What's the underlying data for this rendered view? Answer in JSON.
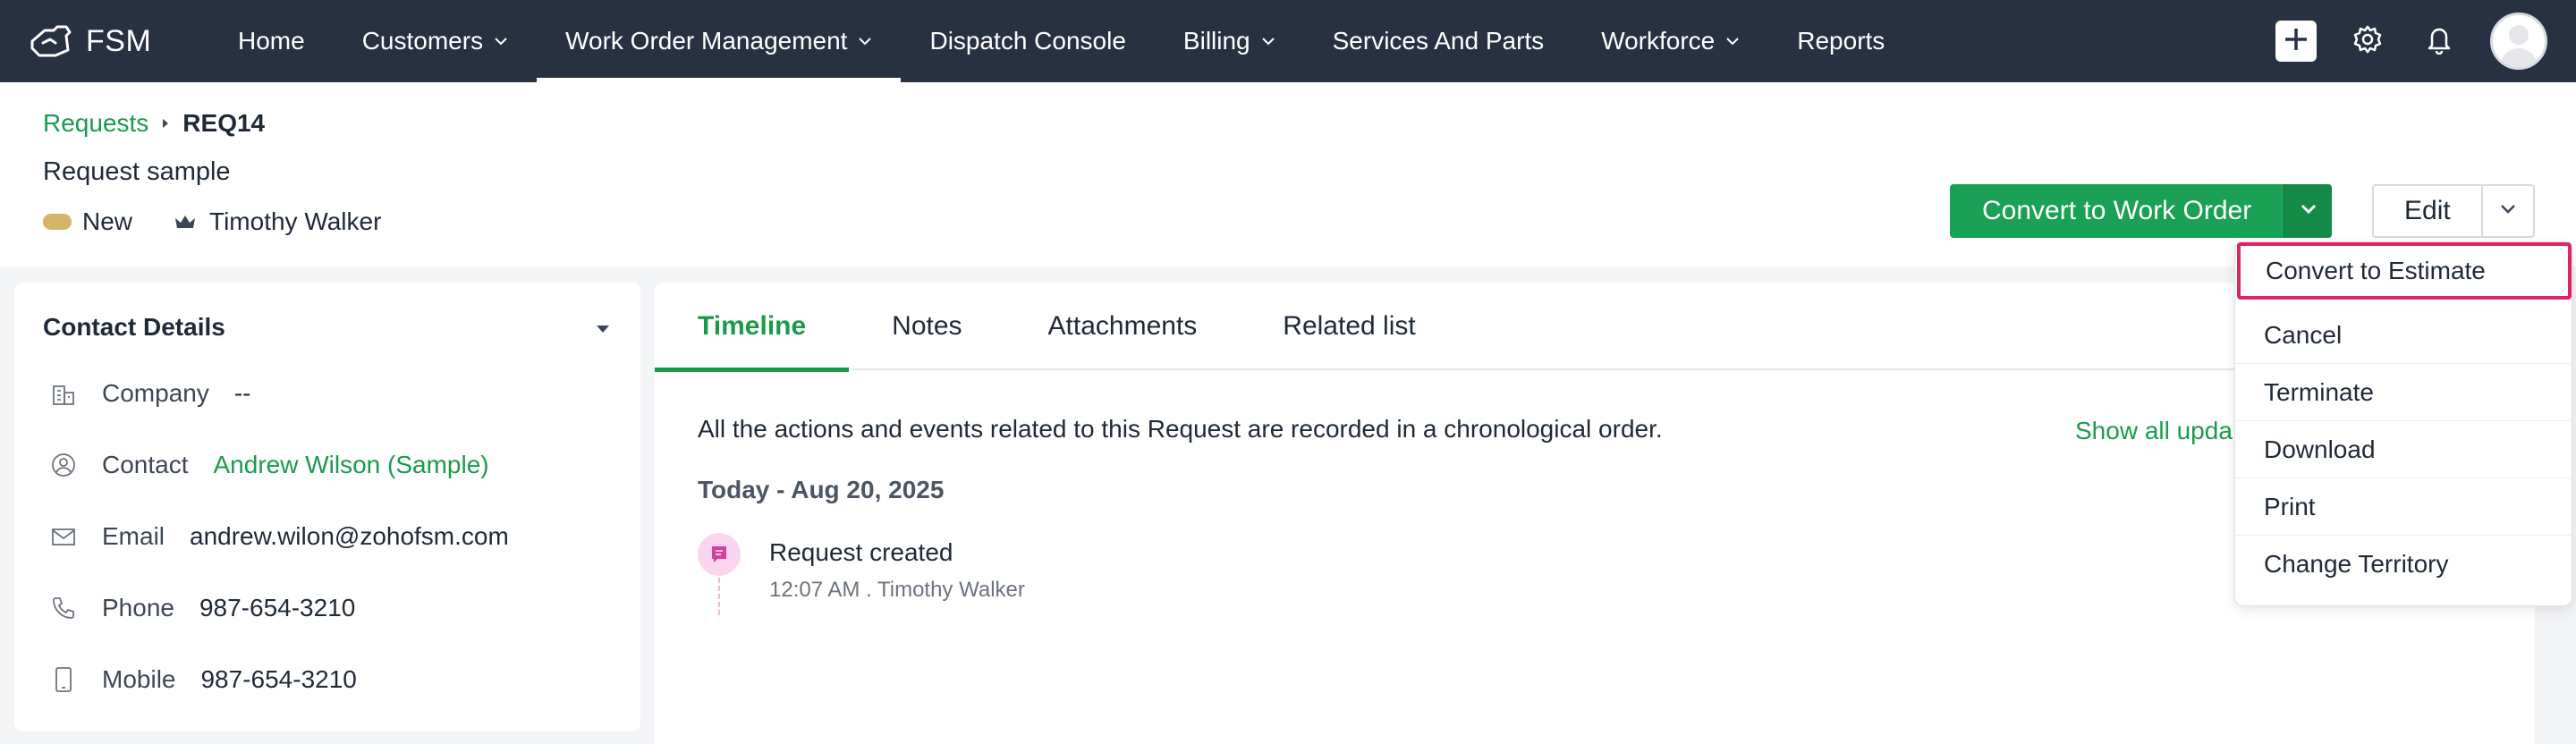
{
  "nav": {
    "brand": "FSM",
    "items": [
      {
        "label": "Home",
        "has_dropdown": false,
        "active": false
      },
      {
        "label": "Customers",
        "has_dropdown": true,
        "active": false
      },
      {
        "label": "Work Order Management",
        "has_dropdown": true,
        "active": true
      },
      {
        "label": "Dispatch Console",
        "has_dropdown": false,
        "active": false
      },
      {
        "label": "Billing",
        "has_dropdown": true,
        "active": false
      },
      {
        "label": "Services And Parts",
        "has_dropdown": false,
        "active": false
      },
      {
        "label": "Workforce",
        "has_dropdown": true,
        "active": false
      },
      {
        "label": "Reports",
        "has_dropdown": false,
        "active": false
      }
    ],
    "icons": [
      "plus-icon",
      "gear-icon",
      "bell-icon",
      "avatar"
    ]
  },
  "header": {
    "breadcrumb_link": "Requests",
    "breadcrumb_current": "REQ14",
    "title": "Request sample",
    "status": "New",
    "status_color": "#d6b46a",
    "owner": "Timothy Walker",
    "primary_action": "Convert to Work Order",
    "edit_action": "Edit"
  },
  "contact": {
    "title": "Contact Details",
    "rows": [
      {
        "icon": "building-icon",
        "label": "Company",
        "value": "--",
        "is_link": false
      },
      {
        "icon": "user-circle-icon",
        "label": "Contact",
        "value": "Andrew Wilson (Sample)",
        "is_link": true
      },
      {
        "icon": "mail-icon",
        "label": "Email",
        "value": "andrew.wilon@zohofsm.com",
        "is_link": false
      },
      {
        "icon": "phone-icon",
        "label": "Phone",
        "value": "987-654-3210",
        "is_link": false
      },
      {
        "icon": "mobile-icon",
        "label": "Mobile",
        "value": "987-654-3210",
        "is_link": false
      }
    ]
  },
  "tabs": [
    {
      "label": "Timeline",
      "active": true
    },
    {
      "label": "Notes",
      "active": false
    },
    {
      "label": "Attachments",
      "active": false
    },
    {
      "label": "Related list",
      "active": false
    }
  ],
  "timeline": {
    "description": "All the actions and events related to this Request are recorded in a chronological order.",
    "show_all": "Show all upda",
    "date_header": "Today - Aug 20, 2025",
    "events": [
      {
        "title": "Request created",
        "meta": "12:07 AM . Timothy Walker"
      }
    ]
  },
  "dropdown_menu": {
    "items": [
      {
        "label": "Convert to Estimate",
        "highlighted": true
      },
      {
        "label": "Cancel",
        "highlighted": false
      },
      {
        "label": "Terminate",
        "highlighted": false
      },
      {
        "label": "Download",
        "highlighted": false
      },
      {
        "label": "Print",
        "highlighted": false
      },
      {
        "label": "Change Territory",
        "highlighted": false
      }
    ]
  },
  "colors": {
    "nav_bg": "#283142",
    "accent_green": "#1aa155",
    "highlight_border": "#e0245e"
  }
}
